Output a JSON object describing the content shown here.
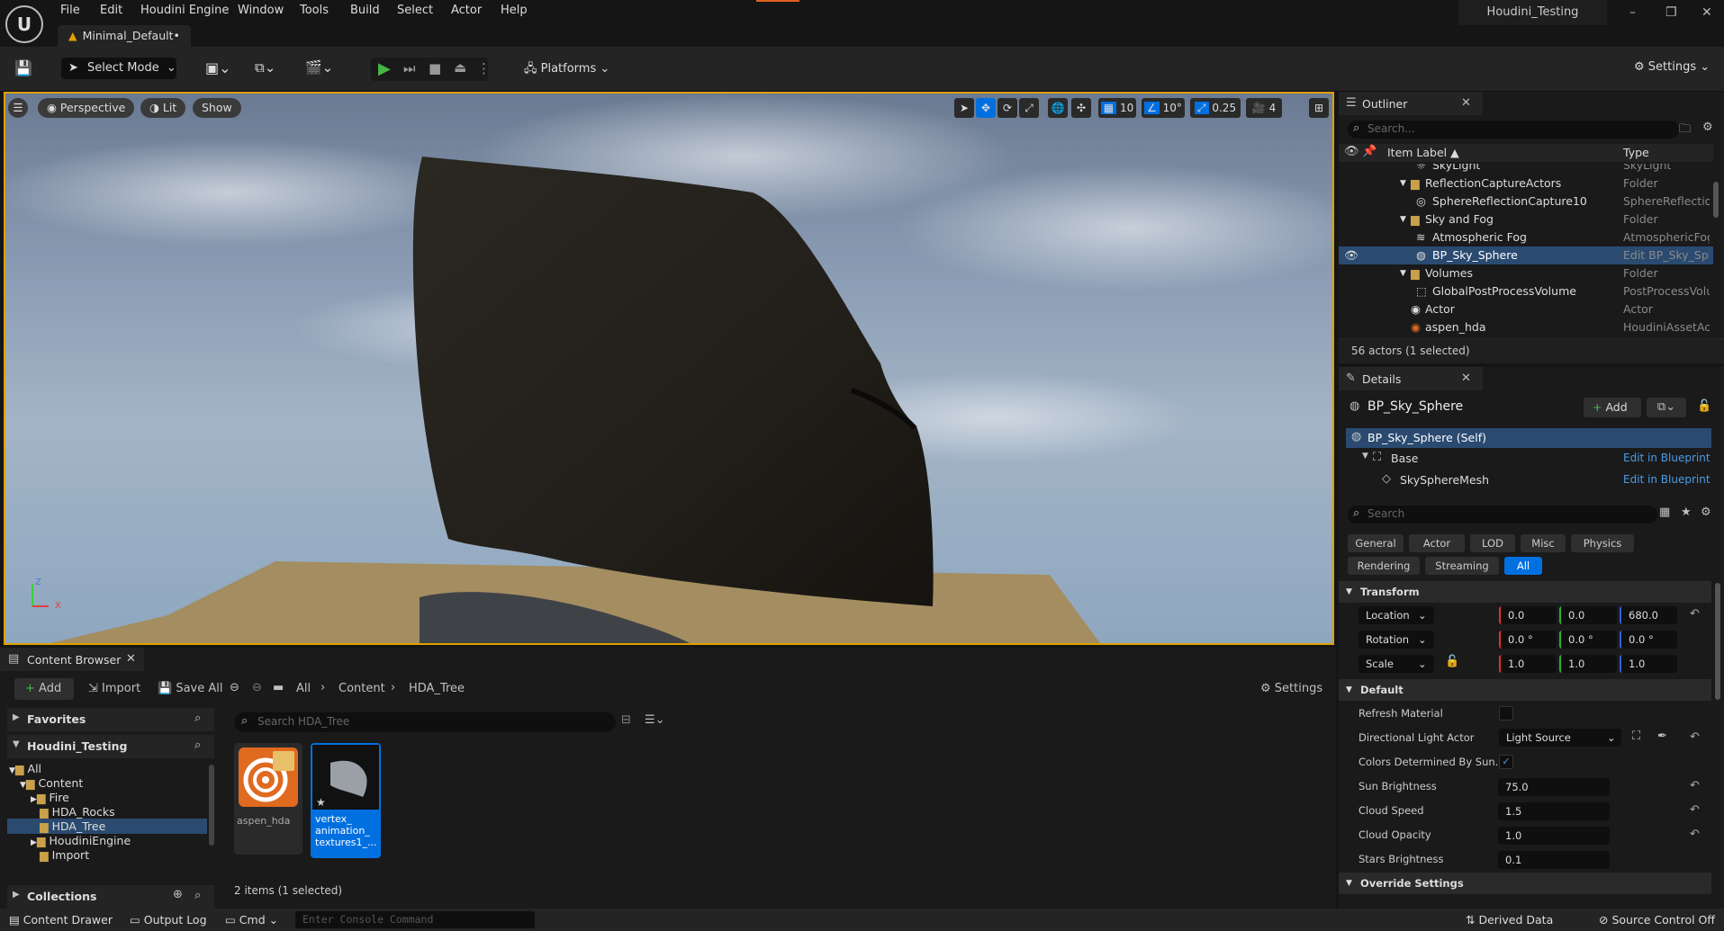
{
  "menubar": {
    "items": [
      "File",
      "Edit",
      "Houdini Engine",
      "Window",
      "Tools",
      "Build",
      "Select",
      "Actor",
      "Help"
    ],
    "level_tab": "Minimal_Default•",
    "project_name": "Houdini_Testing",
    "logo_text": "U"
  },
  "toolbar": {
    "select_mode": "Select Mode",
    "platforms": "Platforms",
    "settings": "Settings"
  },
  "viewport": {
    "perspective": "Perspective",
    "lit": "Lit",
    "show": "Show",
    "grid_snap": "10",
    "rot_snap": "10°",
    "scale_snap": "0.25",
    "cam_speed": "4",
    "axis_z": "Z",
    "axis_x": "X"
  },
  "content_browser": {
    "tab_title": "Content Browser",
    "add": "Add",
    "import": "Import",
    "save_all": "Save All",
    "breadcrumb": [
      "All",
      "Content",
      "HDA_Tree"
    ],
    "settings": "Settings",
    "favorites": "Favorites",
    "project": "Houdini_Testing",
    "tree": [
      "All",
      "Content",
      "Fire",
      "HDA_Rocks",
      "HDA_Tree",
      "HoudiniEngine",
      "Import"
    ],
    "collections": "Collections",
    "search_placeholder": "Search HDA_Tree",
    "assets": [
      {
        "name": "aspen_hda"
      },
      {
        "name": "vertex_ animation_ textures1_..."
      }
    ],
    "item_count": "2 items (1 selected)"
  },
  "outliner": {
    "tab_title": "Outliner",
    "search_placeholder": "Search...",
    "col_label": "Item Label",
    "col_type": "Type",
    "rows": [
      {
        "label": "SkyLight",
        "type": "SkyLight"
      },
      {
        "label": "ReflectionCaptureActors",
        "type": "Folder"
      },
      {
        "label": "SphereReflectionCapture10",
        "type": "SphereReflection"
      },
      {
        "label": "Sky and Fog",
        "type": "Folder"
      },
      {
        "label": "Atmospheric Fog",
        "type": "AtmosphericFog"
      },
      {
        "label": "BP_Sky_Sphere",
        "type": "Edit BP_Sky_Sph"
      },
      {
        "label": "Volumes",
        "type": "Folder"
      },
      {
        "label": "GlobalPostProcessVolume",
        "type": "PostProcessVolu"
      },
      {
        "label": "Actor",
        "type": "Actor"
      },
      {
        "label": "aspen_hda",
        "type": "HoudiniAssetAct"
      }
    ],
    "footer": "56 actors (1 selected)"
  },
  "details": {
    "tab_title": "Details",
    "object_name": "BP_Sky_Sphere",
    "add": "Add",
    "self_row": "BP_Sky_Sphere (Self)",
    "base": "Base",
    "mesh": "SkySphereMesh",
    "edit_bp": "Edit in Blueprint",
    "search_placeholder": "Search",
    "categories_row1": [
      "General",
      "Actor",
      "LOD",
      "Misc",
      "Physics"
    ],
    "categories_row2": [
      "Rendering",
      "Streaming",
      "All"
    ],
    "transform_header": "Transform",
    "location_label": "Location",
    "rotation_label": "Rotation",
    "scale_label": "Scale",
    "location": [
      "0.0",
      "0.0",
      "680.0"
    ],
    "rotation": [
      "0.0 °",
      "0.0 °",
      "0.0 °"
    ],
    "scale": [
      "1.0",
      "1.0",
      "1.0"
    ],
    "default_header": "Default",
    "refresh_material": "Refresh Material",
    "dir_light_actor": "Directional Light Actor",
    "dir_light_value": "Light Source",
    "colors_determined": "Colors Determined By Sun...",
    "sun_brightness_label": "Sun Brightness",
    "sun_brightness": "75.0",
    "cloud_speed_label": "Cloud Speed",
    "cloud_speed": "1.5",
    "cloud_opacity_label": "Cloud Opacity",
    "cloud_opacity": "1.0",
    "stars_brightness_label": "Stars Brightness",
    "stars_brightness": "0.1",
    "override_header": "Override Settings"
  },
  "statusbar": {
    "content_drawer": "Content Drawer",
    "output_log": "Output Log",
    "cmd": "Cmd",
    "console_placeholder": "Enter Console Command",
    "derived_data": "Derived Data",
    "source_control": "Source Control Off"
  },
  "colors": {
    "accent_blue": "#0070e0",
    "selection": "#2a4a70",
    "viewport_border": "#e0a000",
    "play_green": "#44b844"
  }
}
